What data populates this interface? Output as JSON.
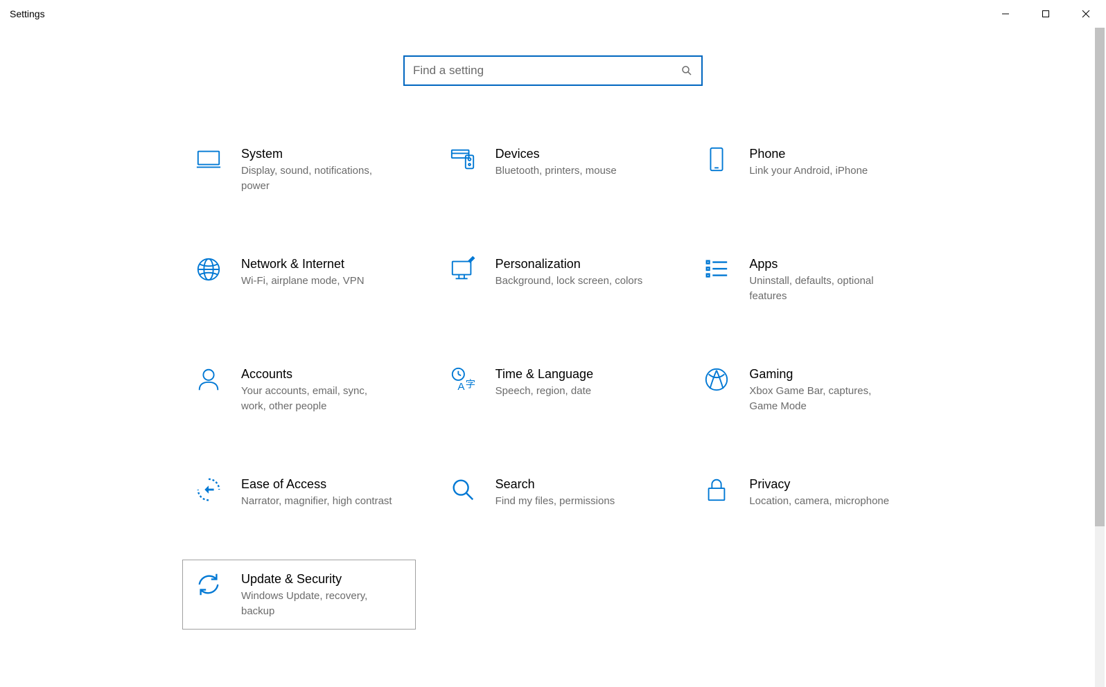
{
  "window": {
    "title": "Settings"
  },
  "search": {
    "placeholder": "Find a setting"
  },
  "tiles": [
    {
      "id": "system",
      "title": "System",
      "desc": "Display, sound, notifications, power"
    },
    {
      "id": "devices",
      "title": "Devices",
      "desc": "Bluetooth, printers, mouse"
    },
    {
      "id": "phone",
      "title": "Phone",
      "desc": "Link your Android, iPhone"
    },
    {
      "id": "network",
      "title": "Network & Internet",
      "desc": "Wi-Fi, airplane mode, VPN"
    },
    {
      "id": "personalization",
      "title": "Personalization",
      "desc": "Background, lock screen, colors"
    },
    {
      "id": "apps",
      "title": "Apps",
      "desc": "Uninstall, defaults, optional features"
    },
    {
      "id": "accounts",
      "title": "Accounts",
      "desc": "Your accounts, email, sync, work, other people"
    },
    {
      "id": "time",
      "title": "Time & Language",
      "desc": "Speech, region, date"
    },
    {
      "id": "gaming",
      "title": "Gaming",
      "desc": "Xbox Game Bar, captures, Game Mode"
    },
    {
      "id": "ease",
      "title": "Ease of Access",
      "desc": "Narrator, magnifier, high contrast"
    },
    {
      "id": "search",
      "title": "Search",
      "desc": "Find my files, permissions"
    },
    {
      "id": "privacy",
      "title": "Privacy",
      "desc": "Location, camera, microphone"
    },
    {
      "id": "update",
      "title": "Update & Security",
      "desc": "Windows Update, recovery, backup"
    }
  ]
}
